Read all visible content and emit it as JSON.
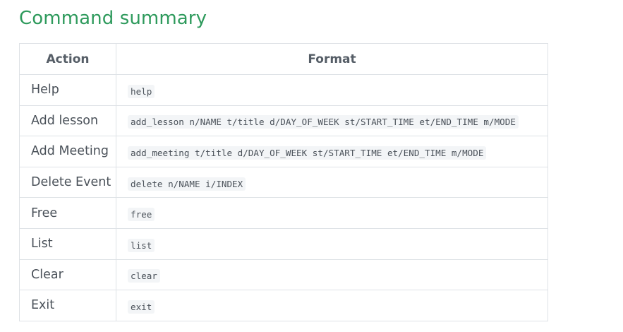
{
  "section": {
    "title": "Command summary"
  },
  "table": {
    "headers": {
      "action": "Action",
      "format": "Format"
    },
    "rows": [
      {
        "action": "Help",
        "format": "help"
      },
      {
        "action": "Add lesson",
        "format": "add_lesson n/NAME t/title d/DAY_OF_WEEK st/START_TIME et/END_TIME m/MODE"
      },
      {
        "action": "Add Meeting",
        "format": "add_meeting t/title d/DAY_OF_WEEK st/START_TIME et/END_TIME m/MODE"
      },
      {
        "action": "Delete Event",
        "format": "delete n/NAME i/INDEX"
      },
      {
        "action": "Free",
        "format": "free"
      },
      {
        "action": "List",
        "format": "list"
      },
      {
        "action": "Clear",
        "format": "clear"
      },
      {
        "action": "Exit",
        "format": "exit"
      }
    ]
  },
  "colors": {
    "title": "#2e9a5c",
    "border": "#dee2e6",
    "code_background": "#f3f5f7"
  }
}
